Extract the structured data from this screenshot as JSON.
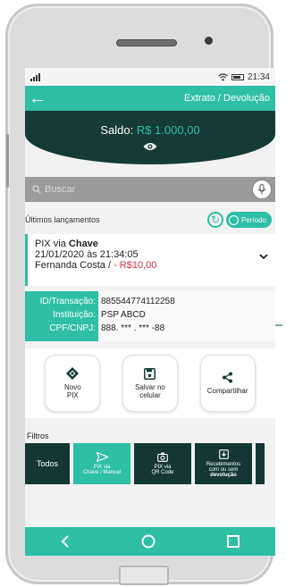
{
  "status": {
    "time": "21:34"
  },
  "appbar": {
    "title": "Extrato / Devolução"
  },
  "balance": {
    "label": "Saldo:",
    "amount": "R$ 1.000,00"
  },
  "search": {
    "placeholder": "Buscar"
  },
  "launches": {
    "heading": "Últimos lançamentos",
    "period_label": "Período"
  },
  "transaction": {
    "type_prefix": "PIX via ",
    "type_bold": "Chave",
    "datetime": "21/01/2020 às 21:34:05",
    "name": "Fernanda Costa",
    "separator": "/",
    "amount": "- R$10,00"
  },
  "details": {
    "labels": [
      "ID/Transação:",
      "Instituição:",
      "CPF/CNPJ:"
    ],
    "values": [
      "885544774112258",
      "PSP ABCD",
      "888. *** . *** -88"
    ]
  },
  "actions": {
    "new_pix": [
      "Novo",
      "PIX"
    ],
    "save": [
      "Salvar no",
      "celular"
    ],
    "share": "Compartilhar"
  },
  "filters": {
    "label": "Filtros",
    "all": "Todos",
    "chave": [
      "PIX via",
      "Chave / Manual"
    ],
    "qrcode": [
      "PIX via",
      "QR Code"
    ],
    "received": [
      "Recebimentos",
      "com ou sem ",
      "devolução"
    ]
  },
  "colors": {
    "accent": "#2ebfa5",
    "dark": "#163a36",
    "negative": "#e0314b"
  }
}
